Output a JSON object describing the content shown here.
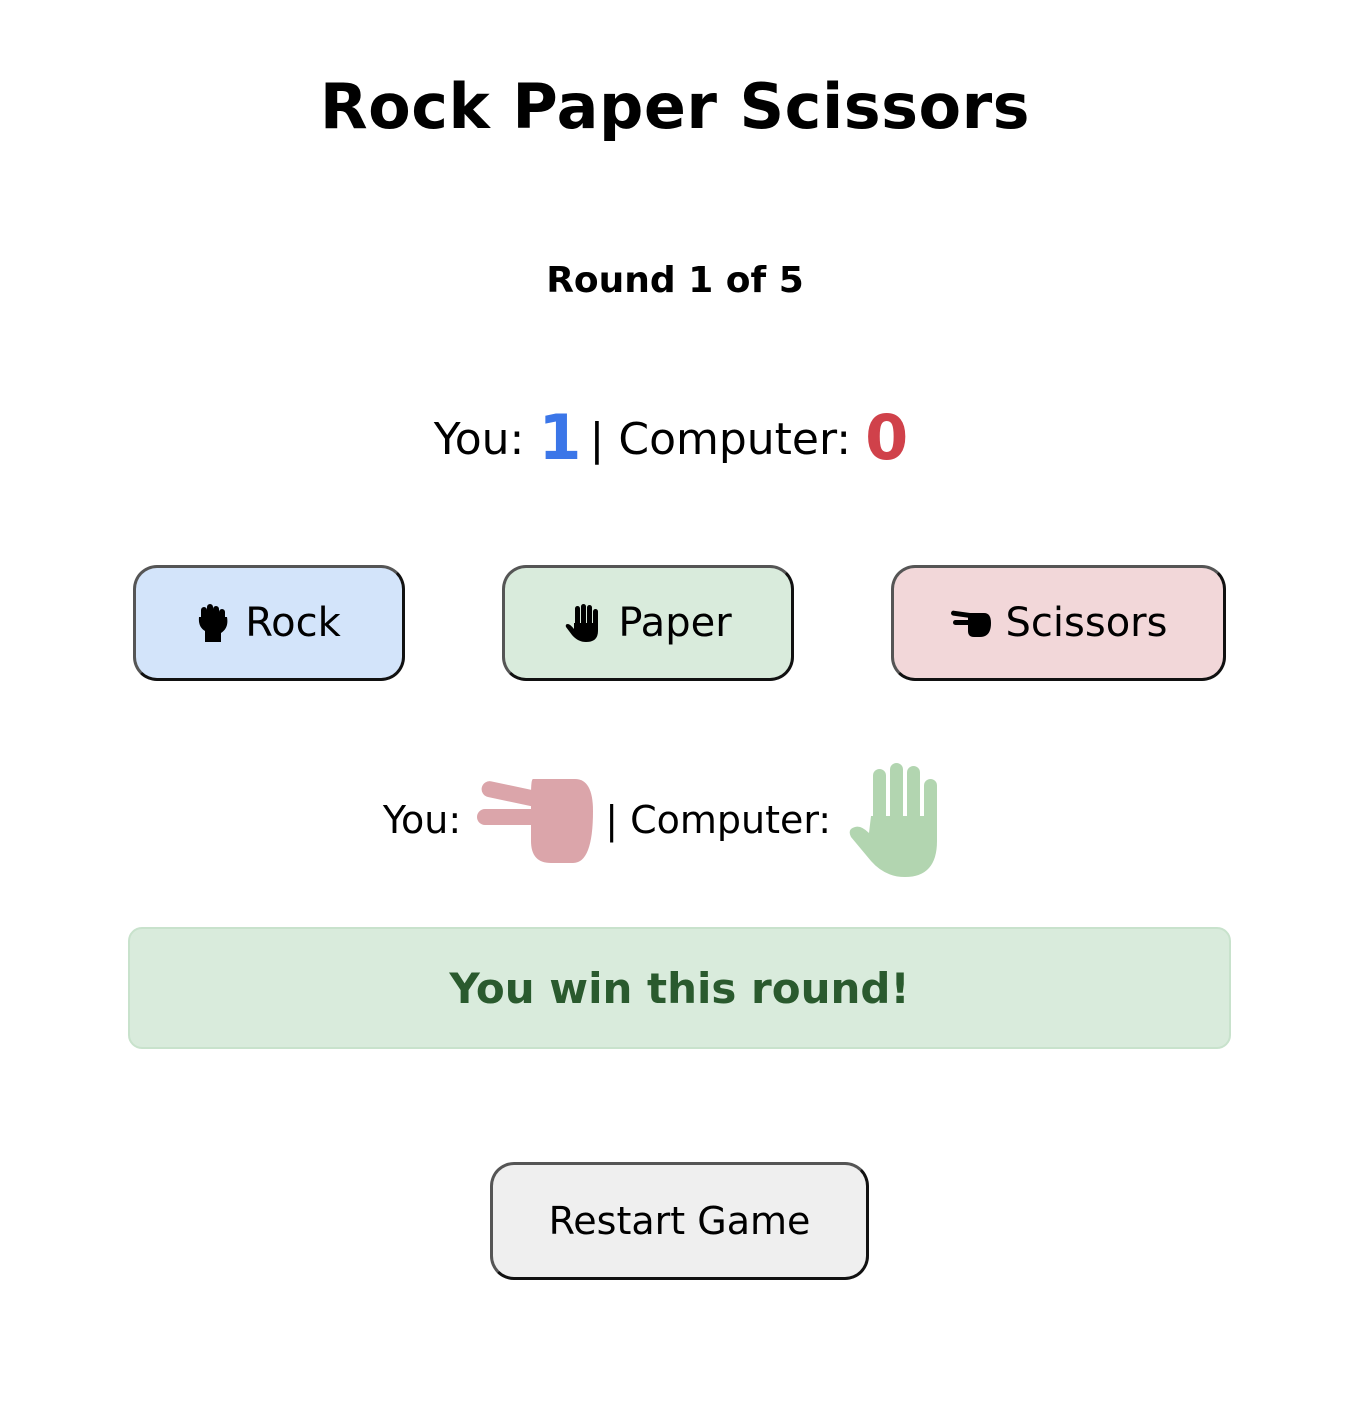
{
  "title": "Rock Paper Scissors",
  "round": "Round 1 of 5",
  "score": {
    "you_label": "You:",
    "you_value": "1",
    "you_color": "#3b76e8",
    "separator": "| Computer:",
    "computer_value": "0",
    "computer_color": "#d0414a"
  },
  "choices_buttons": [
    {
      "label": "Rock",
      "icon": "raised-fist-icon",
      "color": "#d3e4fa"
    },
    {
      "label": "Paper",
      "icon": "raised-hand-icon",
      "color": "#d9ebdc"
    },
    {
      "label": "Scissors",
      "icon": "pointing-hand-icon",
      "color": "#f2d7d9"
    }
  ],
  "last_choices": {
    "you_label": "You:",
    "you_icon": "scissors-hand-icon",
    "you_icon_color": "#dba5aa",
    "separator": "| Computer:",
    "computer_icon": "paper-hand-icon",
    "computer_icon_color": "#b2d5b0"
  },
  "result": {
    "text": "You win this round!",
    "color": "#2a5a2e",
    "background": "#d9ebdc"
  },
  "restart_label": "Restart Game"
}
